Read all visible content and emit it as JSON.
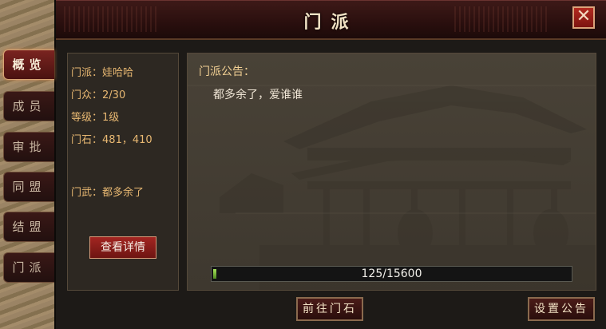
{
  "window": {
    "title": "门派",
    "close_label": "✕"
  },
  "tabs": [
    {
      "label": "概览",
      "active": true
    },
    {
      "label": "成员",
      "active": false
    },
    {
      "label": "审批",
      "active": false
    },
    {
      "label": "同盟",
      "active": false
    },
    {
      "label": "结盟",
      "active": false
    },
    {
      "label": "门派",
      "active": false
    }
  ],
  "info": {
    "sect_label": "门派",
    "sect_value": "娃哈哈",
    "members_label": "门众",
    "members_value": "2/30",
    "level_label": "等级",
    "level_value": "1级",
    "stone_label": "门石",
    "stone_value": "481，410",
    "martial_label": "门武",
    "martial_value": "都多余了",
    "separator": "："
  },
  "detail_button": "查看详情",
  "announcement": {
    "title": "门派公告：",
    "text": "都多余了，爱谁谁"
  },
  "progress": {
    "text": "125/15600",
    "current": 125,
    "max": 15600,
    "fill_fraction": 0.008
  },
  "buttons": {
    "go_stone": "前往门石",
    "set_notice": "设置公告"
  },
  "colors": {
    "info_text": "#e8b872",
    "accent_red": "#a22521",
    "progress_green": "#6fb634"
  }
}
